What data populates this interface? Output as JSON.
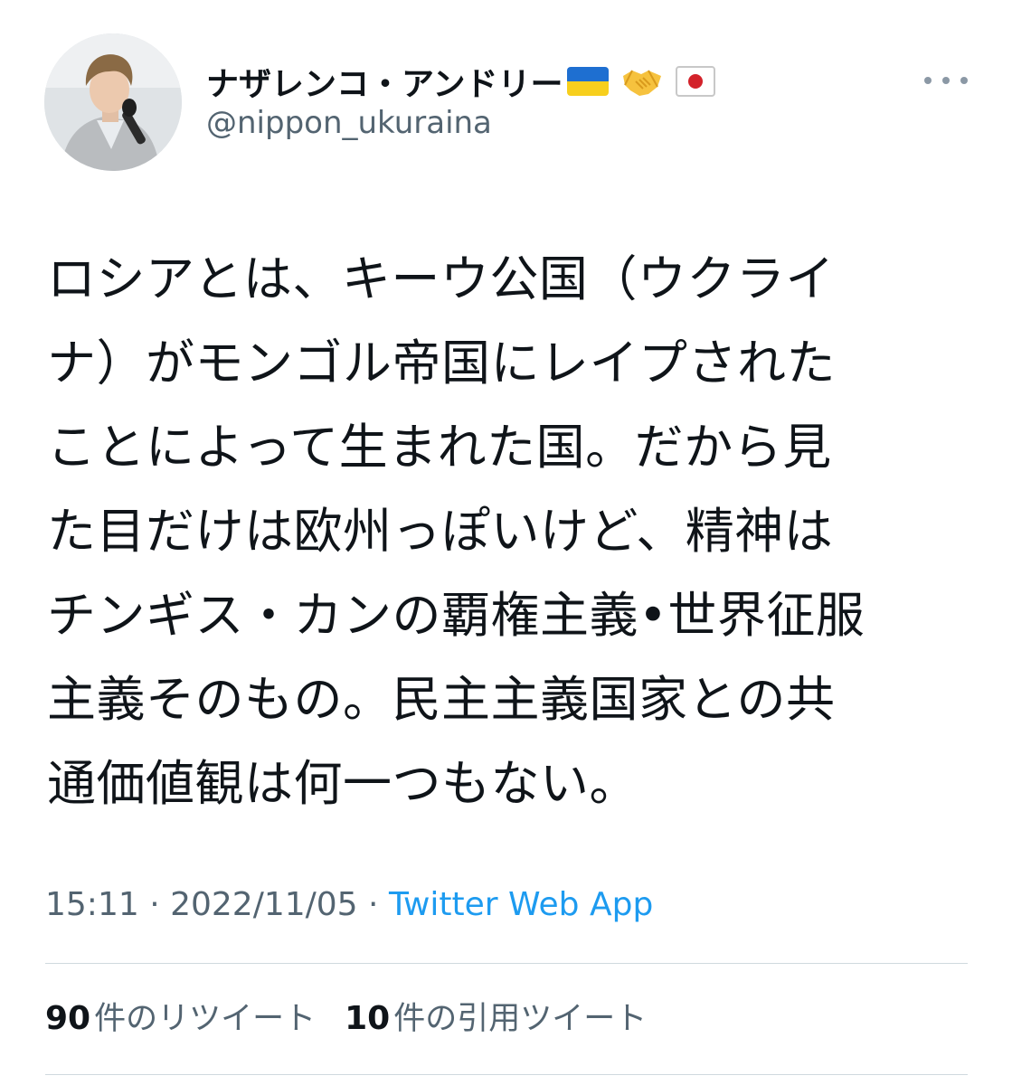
{
  "author": {
    "display_name": "ナザレンコ・アンドリー",
    "handle": "@nippon_ukuraina",
    "avatar": "avatar-photo",
    "name_emojis": [
      "ukraine-flag-icon",
      "handshake-icon",
      "japan-flag-icon"
    ]
  },
  "menu": {
    "icon": "more-icon"
  },
  "tweet": {
    "lines": [
      "ロシアとは、キーウ公国（ウクライ",
      "ナ）がモンゴル帝国にレイプされた",
      "ことによって生まれた国。だから見",
      "た目だけは欧州っぽいけど、精神は",
      "チンギス・カンの覇権主義•世界征服",
      "主義そのもの。民主主義国家との共",
      "通価値観は何一つもない。"
    ]
  },
  "meta": {
    "time": "15:11",
    "sep1": " · ",
    "date": "2022/11/05",
    "sep2": " · ",
    "source": "Twitter Web App"
  },
  "stats": {
    "retweets_count": "90",
    "retweets_label": "件のリツイート",
    "quotes_count": "10",
    "quotes_label": "件の引用ツイート"
  },
  "colors": {
    "text_primary": "#0f1419",
    "text_secondary": "#536471",
    "link": "#1d9bf0",
    "divider": "#cfd9de"
  }
}
